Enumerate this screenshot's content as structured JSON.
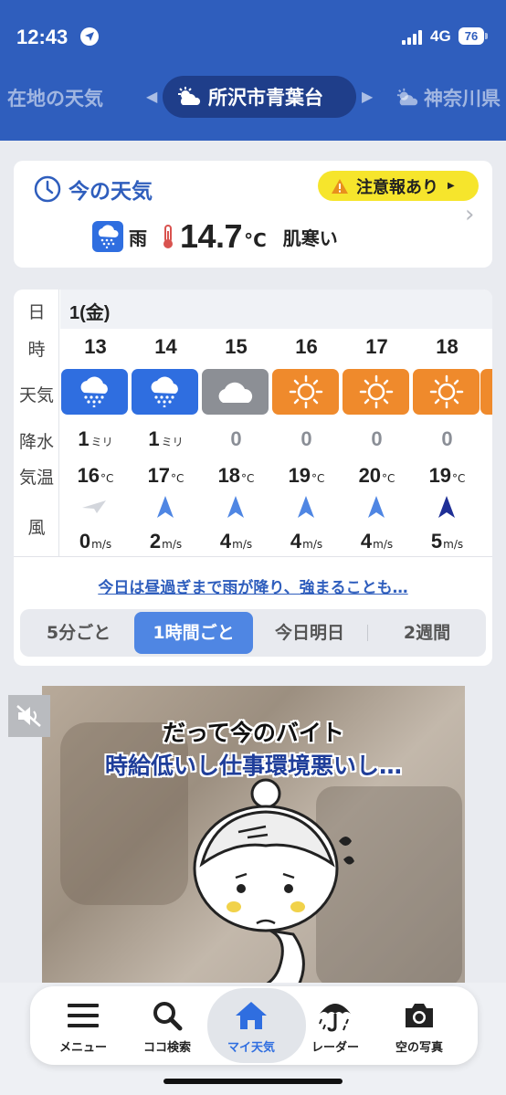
{
  "status_bar": {
    "time": "12:43",
    "network": "4G",
    "battery": "76"
  },
  "location_tabs": {
    "left": "在地の天気",
    "active": "所沢市青葉台",
    "right": "神奈川県"
  },
  "current": {
    "title": "今の天気",
    "alert": "注意報あり",
    "condition": "雨",
    "temperature": "14.7",
    "temp_unit": "°C",
    "feeling": "肌寒い"
  },
  "forecast": {
    "row_labels": {
      "day": "日",
      "hour": "時",
      "weather": "天気",
      "precip": "降水",
      "temp": "気温",
      "wind": "風"
    },
    "day": "1(金)",
    "precip_unit": "ミリ",
    "temp_unit": "°C",
    "wind_unit": "m/s",
    "hours": [
      {
        "hour": "13",
        "weather": "rain",
        "precip": "1",
        "temp": "16",
        "wind_speed": "0",
        "wind_dir": "calm"
      },
      {
        "hour": "14",
        "weather": "rain",
        "precip": "1",
        "temp": "17",
        "wind_speed": "2",
        "wind_dir": "north"
      },
      {
        "hour": "15",
        "weather": "cloudy",
        "precip": "0",
        "temp": "18",
        "wind_speed": "4",
        "wind_dir": "north"
      },
      {
        "hour": "16",
        "weather": "sunny",
        "precip": "0",
        "temp": "19",
        "wind_speed": "4",
        "wind_dir": "north"
      },
      {
        "hour": "17",
        "weather": "sunny",
        "precip": "0",
        "temp": "20",
        "wind_speed": "4",
        "wind_dir": "north"
      },
      {
        "hour": "18",
        "weather": "sunny",
        "precip": "0",
        "temp": "19",
        "wind_speed": "5",
        "wind_dir": "north"
      }
    ],
    "summary": "今日は昼過ぎまで雨が降り、強まることも…",
    "segments": [
      "5分ごと",
      "1時間ごと",
      "今日明日",
      "2週間"
    ],
    "active_segment": "1時間ごと"
  },
  "ad": {
    "line1": "だって今のバイト",
    "line2": "時給低いし仕事環境悪いし…"
  },
  "bottom_nav": {
    "items": [
      "メニュー",
      "ココ検索",
      "マイ天気",
      "レーダー",
      "空の写真"
    ],
    "active": "マイ天気"
  },
  "colors": {
    "header": "#2f5ebd",
    "rain": "#2f6ee0",
    "cloudy": "#8c8f95",
    "sunny": "#ef8a2c",
    "alert": "#f6e52c",
    "accent": "#4f86e3"
  }
}
